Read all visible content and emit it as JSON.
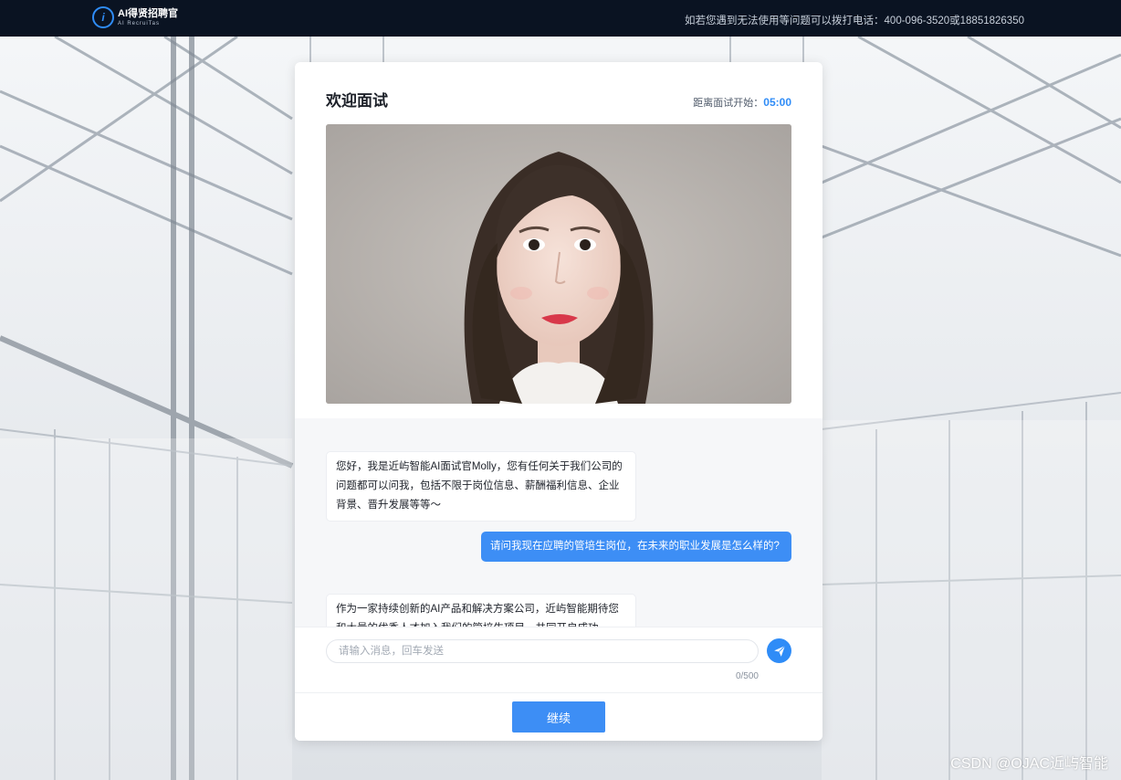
{
  "topbar": {
    "logo_title": "AI得贤招聘官",
    "logo_sub": "AI RecruiTas",
    "logo_glyph": "i",
    "hotline": "如若您遇到无法使用等问题可以拨打电话：400-096-3520或18851826350"
  },
  "card": {
    "title": "欢迎面试",
    "countdown_label": "距离面试开始：",
    "countdown_value": "05:00"
  },
  "chat": {
    "messages": [
      {
        "role": "bot",
        "text": "您好，我是近屿智能AI面试官Molly，您有任何关于我们公司的问题都可以问我，包括不限于岗位信息、薪酬福利信息、企业背景、晋升发展等等～"
      },
      {
        "role": "user",
        "text": "请问我现在应聘的管培生岗位，在未来的职业发展是怎么样的?"
      },
      {
        "role": "bot",
        "text": "作为一家持续创新的AI产品和解决方案公司，近屿智能期待您和大量的优秀人才加入我们的管培生项目，共同开启成功"
      }
    ]
  },
  "input": {
    "placeholder": "请输入消息，回车发送",
    "value": "",
    "counter": "0/500"
  },
  "footer": {
    "continue_label": "继续"
  },
  "watermark": "CSDN @OJAC近屿智能",
  "colors": {
    "accent": "#2f8cf7",
    "topbar": "#0a1322",
    "user_bubble": "#3d8ef5"
  },
  "icons": {
    "send": "paper-plane-icon",
    "logo": "ai-logo-icon"
  }
}
